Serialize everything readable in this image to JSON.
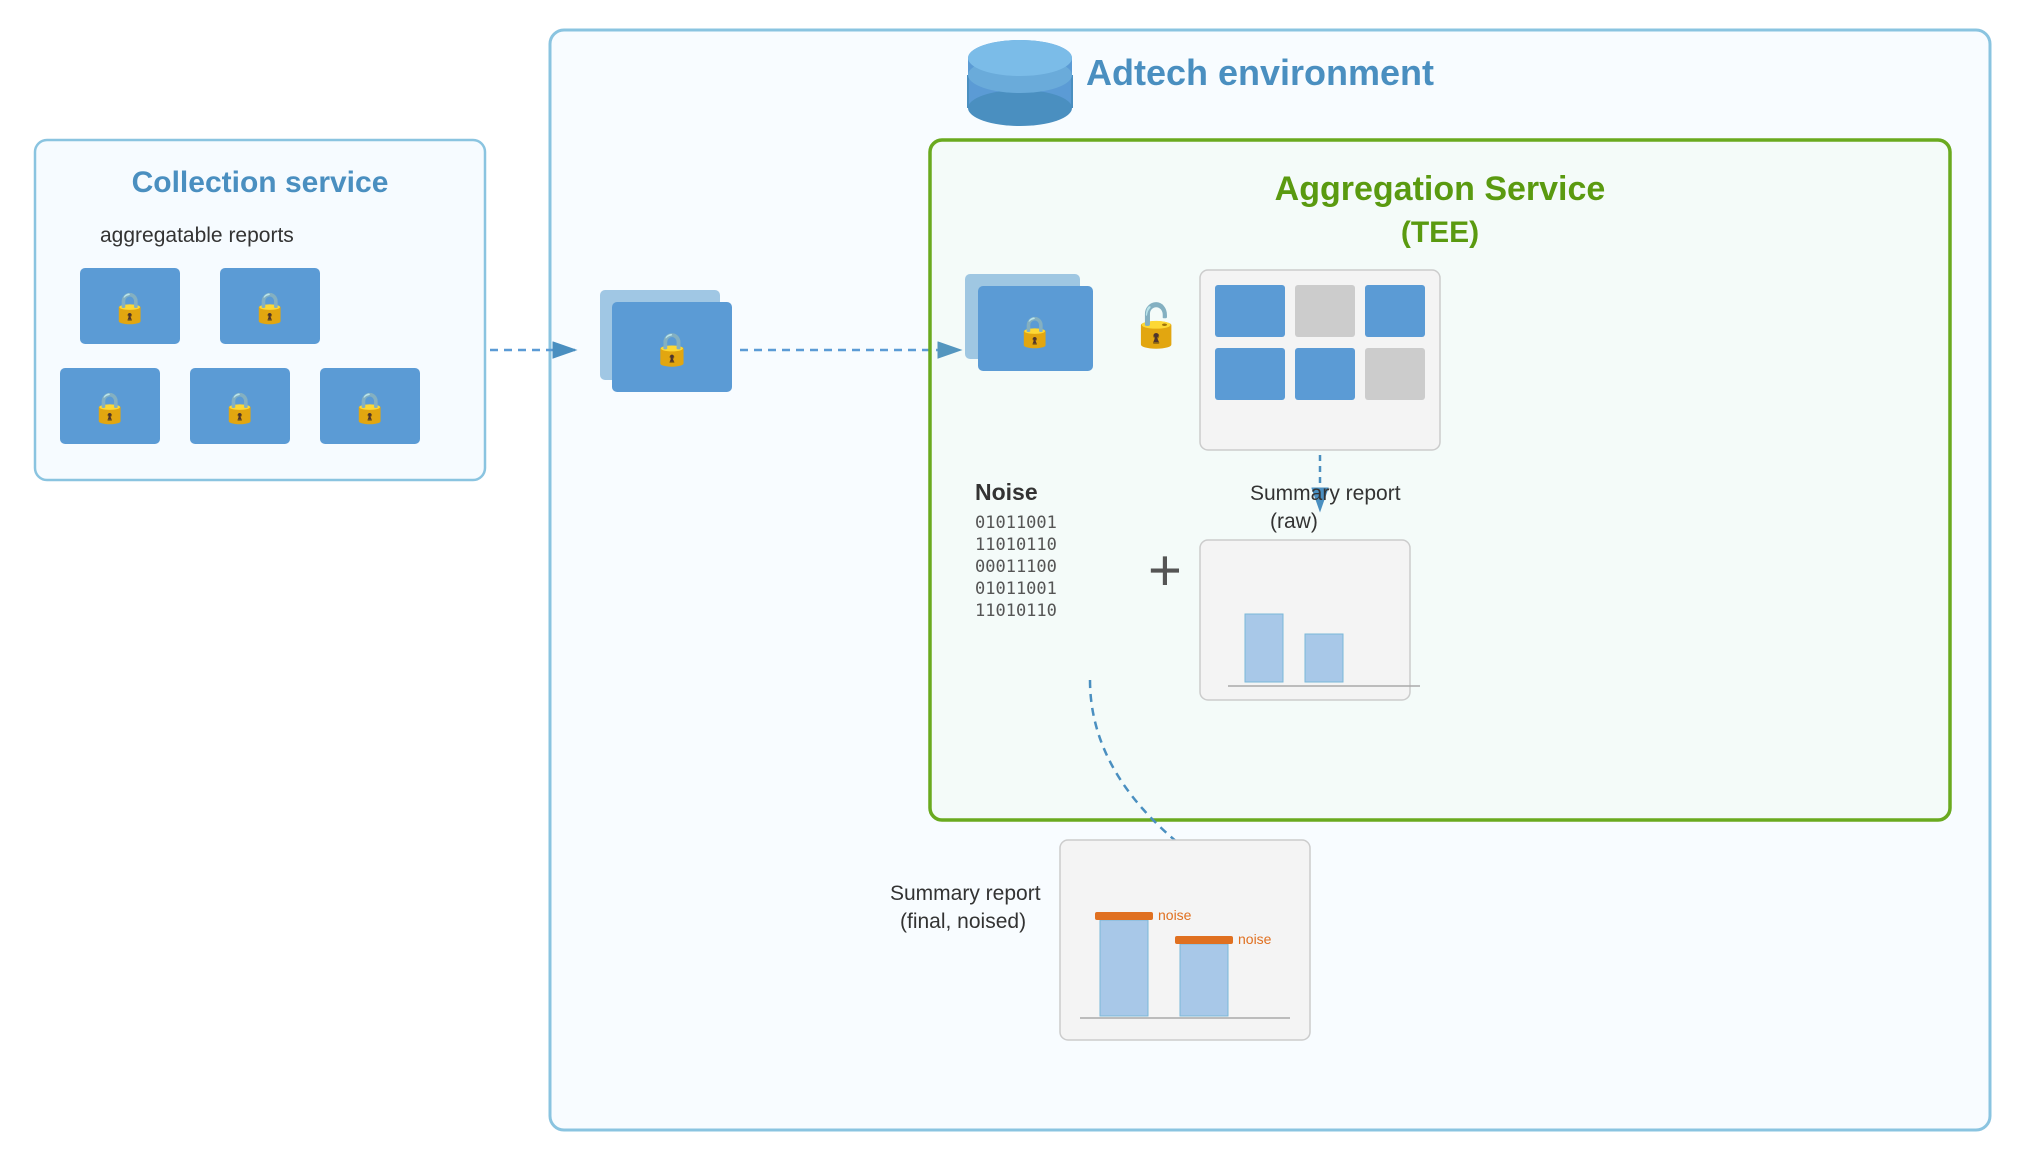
{
  "diagram": {
    "adtech_label": "Adtech environment",
    "collection_service_label": "Collection service",
    "aggregatable_reports_text": "aggregatable reports",
    "aggregation_service_label": "Aggregation Service",
    "aggregation_service_sublabel": "(TEE)",
    "noise_label": "Noise",
    "noise_binary": [
      "01011001",
      "11010110",
      "00011100",
      "01011001",
      "11010110"
    ],
    "summary_report_raw_label": "Summary report",
    "summary_report_raw_sublabel": "(raw)",
    "summary_report_final_label": "Summary report",
    "summary_report_final_sublabel": "(final, noised)",
    "noise_bar_label1": "noise",
    "noise_bar_label2": "noise",
    "plus_sign": "+"
  }
}
